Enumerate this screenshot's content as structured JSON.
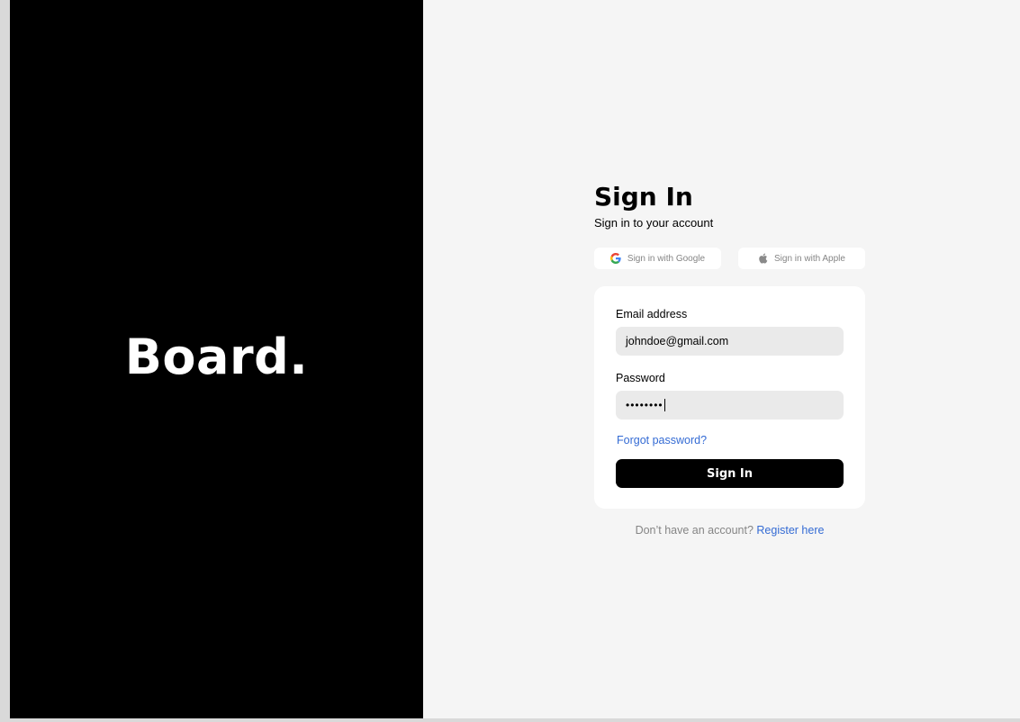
{
  "brand": {
    "name": "Board."
  },
  "signin": {
    "title": "Sign In",
    "subtitle": "Sign in to your account",
    "google_label": "Sign in with Google",
    "apple_label": "Sign in with Apple",
    "email_label": "Email address",
    "email_value": "johndoe@gmail.com",
    "password_label": "Password",
    "password_mask": "••••••••",
    "forgot_label": "Forgot password?",
    "submit_label": "Sign In",
    "no_account_text": "Don’t have an account?",
    "register_label": "Register here"
  },
  "icons": {
    "google": "google-icon",
    "apple": "apple-icon"
  },
  "colors": {
    "left_panel": "#000000",
    "right_panel": "#f5f5f5",
    "link": "#346bd4",
    "input_bg": "#eaeaea",
    "button_bg": "#000000"
  }
}
